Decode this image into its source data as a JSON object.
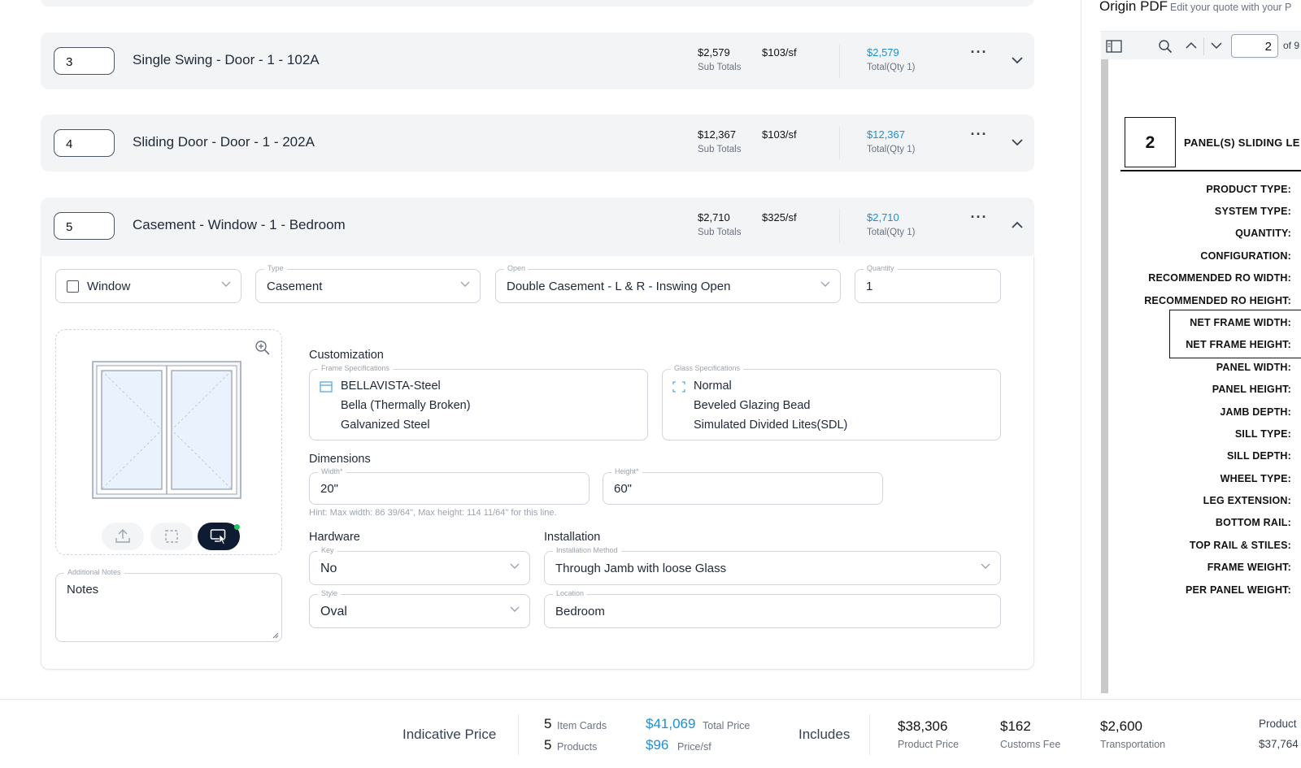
{
  "rows": [
    {
      "number": "3",
      "title": "Single Swing - Door - 1 - 102A",
      "subtotal": "$2,579",
      "subtotal_label": "Sub Totals",
      "price_sf": "$103/sf",
      "total": "$2,579",
      "total_label": "Total(Qty 1)"
    },
    {
      "number": "4",
      "title": "Sliding Door - Door - 1 - 202A",
      "subtotal": "$12,367",
      "subtotal_label": "Sub Totals",
      "price_sf": "$103/sf",
      "total": "$12,367",
      "total_label": "Total(Qty 1)"
    },
    {
      "number": "5",
      "title": "Casement - Window - 1 - Bedroom",
      "subtotal": "$2,710",
      "subtotal_label": "Sub Totals",
      "price_sf": "$325/sf",
      "total": "$2,710",
      "total_label": "Total(Qty 1)"
    }
  ],
  "more_label": "···",
  "detail": {
    "category": {
      "value": "Window"
    },
    "type": {
      "label": "Type",
      "value": "Casement"
    },
    "open": {
      "label": "Open",
      "value": "Double Casement - L & R - Inswing Open"
    },
    "quantity": {
      "label": "Quantity",
      "value": "1"
    },
    "customization_title": "Customization",
    "frame_specs": {
      "label": "Frame Specifications",
      "lines": [
        "BELLAVISTA-Steel",
        "Bella (Thermally Broken)",
        "Galvanized Steel"
      ]
    },
    "glass_specs": {
      "label": "Glass Specifications",
      "lines": [
        "Normal",
        "Beveled Glazing Bead",
        "Simulated Divided Lites(SDL)"
      ]
    },
    "dimensions_title": "Dimensions",
    "width": {
      "label": "Width*",
      "value": "20\""
    },
    "height": {
      "label": "Height*",
      "value": "60\""
    },
    "hint": "Hint: Max width: 86 39/64\", Max height: 114 11/64\" for this line.",
    "hardware_title": "Hardware",
    "key": {
      "label": "Key",
      "value": "No"
    },
    "style": {
      "label": "Style",
      "value": "Oval"
    },
    "installation_title": "Installation",
    "install_method": {
      "label": "Installation Method",
      "value": "Through Jamb with loose Glass"
    },
    "location": {
      "label": "Location",
      "value": "Bedroom"
    },
    "notes": {
      "label": "Additional Notes",
      "value": "Notes"
    }
  },
  "pdf": {
    "title": "Origin PDF",
    "subtitle": "Edit your quote with your P",
    "page_value": "2",
    "page_of": "of 9",
    "panel_count": "2",
    "panel_heading": "PANEL(S) SLIDING LE",
    "spec_labels": [
      "PRODUCT TYPE:",
      "SYSTEM TYPE:",
      "QUANTITY:",
      "CONFIGURATION:",
      "RECOMMENDED RO WIDTH:",
      "RECOMMENDED RO HEIGHT:",
      "NET FRAME WIDTH:",
      "NET FRAME HEIGHT:",
      "PANEL WIDTH:",
      "PANEL HEIGHT:",
      "JAMB DEPTH:",
      "SILL TYPE:",
      "SILL DEPTH:",
      "WHEEL TYPE:",
      "LEG EXTENSION:",
      "BOTTOM RAIL:",
      "TOP RAIL & STILES:",
      "FRAME WEIGHT:",
      "PER PANEL WEIGHT:"
    ]
  },
  "footer": {
    "indicative_label": "Indicative Price",
    "item_cards_count": "5",
    "item_cards_label": "Item Cards",
    "products_count": "5",
    "products_label": "Products",
    "total_price": "$41,069",
    "total_price_label": "Total Price",
    "price_sf": "$96",
    "price_sf_label": "Price/sf",
    "includes_label": "Includes",
    "product_price": "$38,306",
    "product_price_label": "Product Price",
    "customs_fee": "$162",
    "customs_fee_label": "Customs Fee",
    "transportation": "$2,600",
    "transportation_label": "Transportation",
    "product_cut_label": "Product",
    "product_cut_value": "$37,764"
  },
  "colors": {
    "accent_blue": "#1a8fd6",
    "dark_navy": "#0f1b33",
    "card_gray": "#f3f4f6",
    "status_green": "#22c55e"
  }
}
